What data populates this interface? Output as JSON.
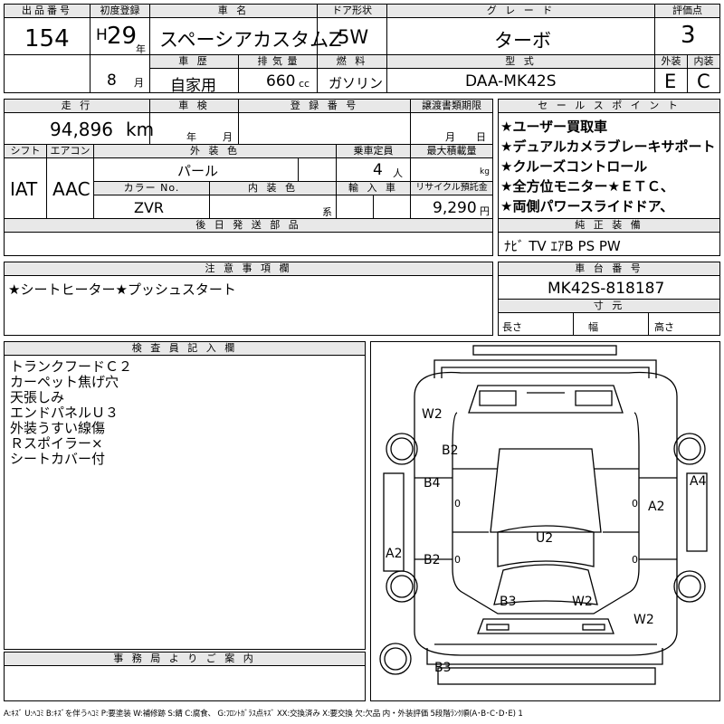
{
  "top": {
    "lot_label": "出品番号",
    "lot_value": "154",
    "reg_label": "初度登録",
    "era": "H",
    "year": "29",
    "year_unit": "年",
    "month": "8",
    "month_unit": "月",
    "name_label": "車 名",
    "name_value": "スペーシアカスタムZ",
    "door_label": "ドア形状",
    "door_value": "5W",
    "grade_label": "グ レ ー ド",
    "grade_value": "ターボ",
    "score_label": "評価点",
    "score_value": "3",
    "history_label": "車 歴",
    "history_value": "自家用",
    "disp_label": "排 気 量",
    "disp_value": "660",
    "disp_unit": "cc",
    "fuel_label": "燃 料",
    "fuel_value": "ガソリン",
    "model_label": "型 式",
    "model_value": "DAA-MK42S",
    "ext_label": "外装",
    "ext_value": "E",
    "int_label": "内装",
    "int_value": "C"
  },
  "mid": {
    "mileage_label": "走 行",
    "mileage_value": "94,896",
    "mileage_unit": "km",
    "inspect_label": "車 検",
    "inspect_year": "年",
    "inspect_month": "月",
    "regno_label": "登 録 番 号",
    "transfer_label": "譲渡書類期限",
    "transfer_month": "月",
    "transfer_day": "日",
    "shift_label": "シフト",
    "shift_value": "IAT",
    "ac_label": "エアコン",
    "ac_value": "AAC",
    "color_label": "外 装 色",
    "color_value": "パール",
    "seats_label": "乗車定員",
    "seats_value": "4",
    "seats_unit": "人",
    "load_label": "最大積載量",
    "load_unit": "kg",
    "colorno_label": "カラー No.",
    "colorno_value": "ZVR",
    "intcolor_label": "内 装 色",
    "intcolor_unit": "系",
    "import_label": "輸 入 車",
    "recycle_label": "リサイクル預託金",
    "recycle_value": "9,290",
    "recycle_unit": "円",
    "later_label": "後 日 発 送 部 品"
  },
  "sales": {
    "label": "セ ー ル ス ポ イ ン ト",
    "items": [
      "★ユーザー買取車",
      "★デュアルカメラブレーキサポート",
      "★クルーズコントロール",
      "★全方位モニター★ＥＴＣ、",
      "★両側パワースライドドア、"
    ]
  },
  "equip": {
    "label": "純 正 装 備",
    "value": "ﾅﾋﾞ TV ｴｱB PS PW"
  },
  "notes": {
    "label": "注 意 事 項 欄",
    "value": "★シートヒーター★プッシュスタート"
  },
  "chassis": {
    "label": "車 台 番 号",
    "value": "MK42S-818187",
    "dims_label": "寸 元",
    "len": "長さ",
    "width": "幅",
    "height": "高さ"
  },
  "inspector": {
    "label": "検 査 員 記 入 欄",
    "lines": [
      "トランクフードＣ２",
      "カーペット焦げ穴",
      "天張しみ",
      "エンドパネルＵ３",
      "外装うすい線傷",
      "Ｒスポイラー×",
      "シートカバー付"
    ]
  },
  "office": {
    "label": "事 務 局 よ り ご 案 内"
  },
  "diagram": {
    "marks": [
      "W2",
      "B2",
      "B4",
      "A4",
      "A2",
      "U2",
      "A2",
      "B2",
      "B3",
      "W2",
      "W2",
      "B3"
    ],
    "zero": "0"
  },
  "legend": "A:ｷｽﾞ U:ﾍｺﾐ B:ｷｽﾞを伴うﾍｺﾐ P:要塗装 W:補修跡 S:錆 C:腐食、 G:ﾌﾛﾝﾄｶﾞﾗｽ点ｷｽﾞ XX:交換済み X:要交換 欠:欠品 内・外装評価 5段階ﾗﾝｸ順(A･B･C･D･E) 1"
}
